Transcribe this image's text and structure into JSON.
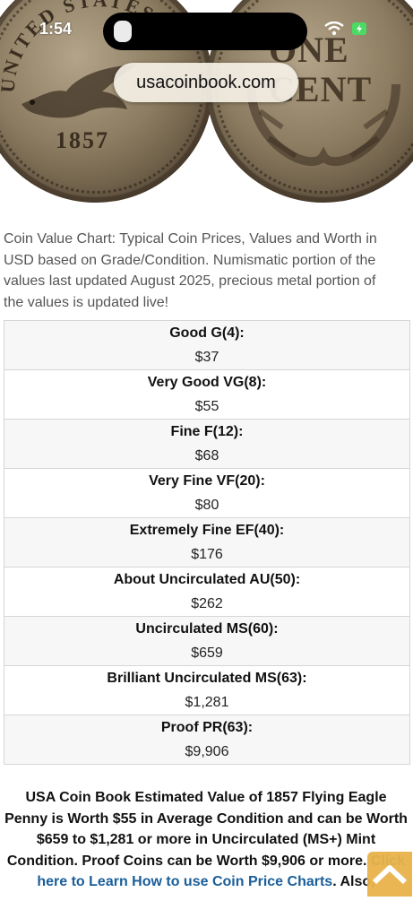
{
  "status_bar": {
    "time": "1:54"
  },
  "browser": {
    "url": "usacoinbook.com"
  },
  "hero": {
    "obverse_legend": "UNITED STATES OF",
    "obverse_date": "1857",
    "reverse_text": [
      "ONE",
      "CENT"
    ]
  },
  "description": "Coin Value Chart: Typical Coin Prices, Values and Worth in USD based on Grade/Condition. Numismatic portion of the values last updated August 2025, precious metal portion of the values is updated live!",
  "grades": [
    {
      "label": "Good G(4):",
      "value": "$37"
    },
    {
      "label": "Very Good VG(8):",
      "value": "$55"
    },
    {
      "label": "Fine F(12):",
      "value": "$68"
    },
    {
      "label": "Very Fine VF(20):",
      "value": "$80"
    },
    {
      "label": "Extremely Fine EF(40):",
      "value": "$176"
    },
    {
      "label": "About Uncirculated AU(50):",
      "value": "$262"
    },
    {
      "label": "Uncirculated MS(60):",
      "value": "$659"
    },
    {
      "label": "Brilliant Uncirculated MS(63):",
      "value": "$1,281"
    },
    {
      "label": "Proof PR(63):",
      "value": "$9,906"
    }
  ],
  "summary": {
    "text": "USA Coin Book Estimated Value of 1857 Flying Eagle Penny is Worth $55 in Average Condition and can be Worth $659 to $1,281 or more in Uncirculated (MS+) Mint Condition. Proof Coins can be Worth $9,906 or more.",
    "link_text": "Click here to Learn How to use Coin Price Charts",
    "trailing": ". Also,"
  },
  "colors": {
    "link": "#1a5e9a",
    "accent": "#e8b34a"
  },
  "icons": [
    "wifi-icon",
    "battery-charging-icon",
    "flashlight-icon",
    "scroll-to-top-icon"
  ]
}
